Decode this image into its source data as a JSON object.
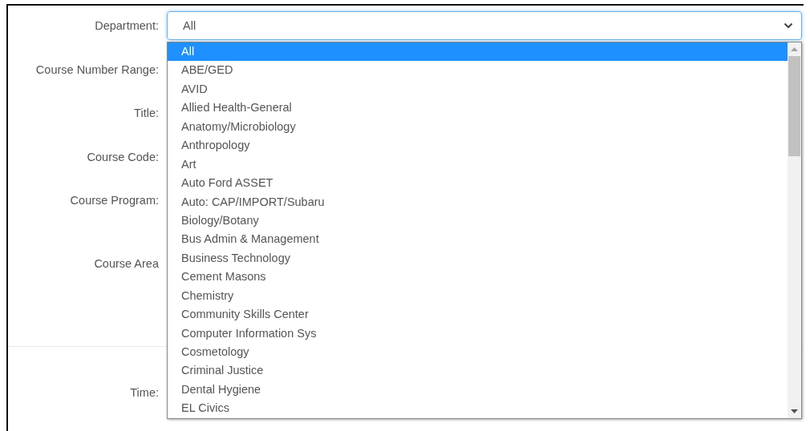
{
  "sections": [
    {
      "fields": [
        {
          "label": "Department:"
        },
        {
          "label": "Course Number Range:"
        },
        {
          "label": "Title:"
        },
        {
          "label": "Course Code:"
        },
        {
          "label": "Course Program:"
        },
        {
          "label": "Course Area"
        }
      ]
    },
    {
      "fields": [
        {
          "label": "Time:"
        }
      ]
    }
  ],
  "department_select": {
    "value": "All",
    "expanded": true,
    "options": [
      {
        "label": "All",
        "selected": true
      },
      {
        "label": "ABE/GED",
        "selected": false
      },
      {
        "label": "AVID",
        "selected": false
      },
      {
        "label": "Allied Health-General",
        "selected": false
      },
      {
        "label": "Anatomy/Microbiology",
        "selected": false
      },
      {
        "label": "Anthropology",
        "selected": false
      },
      {
        "label": "Art",
        "selected": false
      },
      {
        "label": "Auto Ford ASSET",
        "selected": false
      },
      {
        "label": "Auto: CAP/IMPORT/Subaru",
        "selected": false
      },
      {
        "label": "Biology/Botany",
        "selected": false
      },
      {
        "label": "Bus Admin & Management",
        "selected": false
      },
      {
        "label": "Business Technology",
        "selected": false
      },
      {
        "label": "Cement Masons",
        "selected": false
      },
      {
        "label": "Chemistry",
        "selected": false
      },
      {
        "label": "Community Skills Center",
        "selected": false
      },
      {
        "label": "Computer Information Sys",
        "selected": false
      },
      {
        "label": "Cosmetology",
        "selected": false
      },
      {
        "label": "Criminal Justice",
        "selected": false
      },
      {
        "label": "Dental Hygiene",
        "selected": false
      },
      {
        "label": "EL Civics",
        "selected": false
      }
    ]
  }
}
